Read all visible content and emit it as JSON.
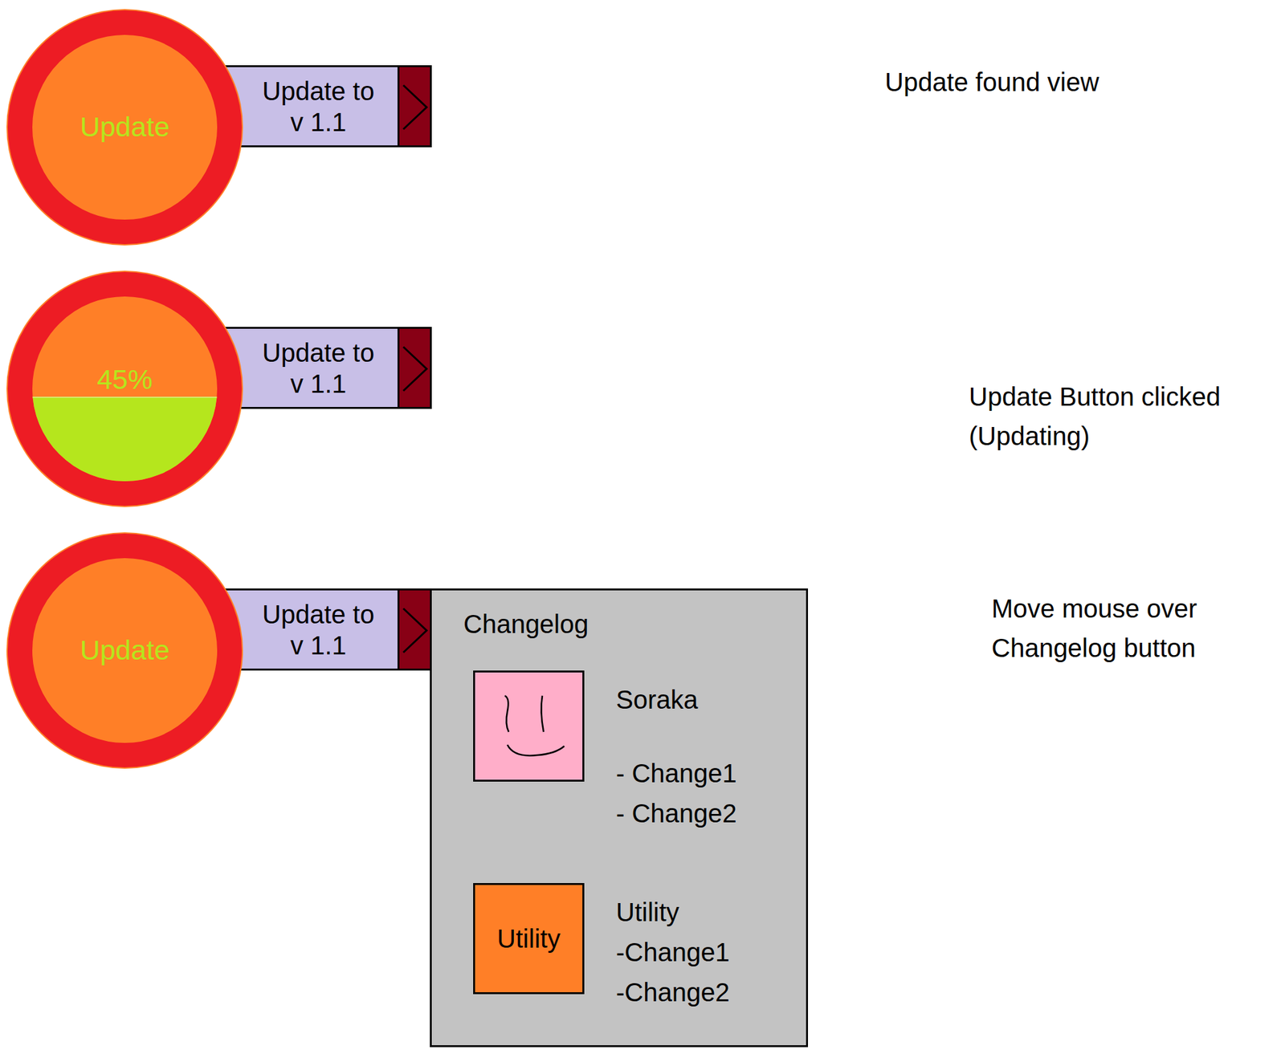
{
  "views": [
    {
      "kind": "idle",
      "button_label": "Update",
      "target": {
        "line1": "Update to",
        "line2": "v 1.1"
      },
      "changelog_open": false,
      "annotation": [
        "Update found view"
      ]
    },
    {
      "kind": "progress",
      "button_label": "45%",
      "level": 0.45,
      "target": {
        "line1": "Update to",
        "line2": "v 1.1"
      },
      "changelog_open": false,
      "annotation": [
        "Update Button clicked",
        "(Updating)"
      ]
    },
    {
      "kind": "idle",
      "button_label": "Update",
      "target": {
        "line1": "Update to",
        "line2": "v 1.1"
      },
      "changelog_open": true,
      "annotation": [
        "Move mouse over",
        "Changelog button"
      ]
    }
  ],
  "changelog": {
    "title": "Changelog",
    "sections": [
      {
        "name": "Soraka",
        "kind": "face",
        "color": "#ffaec9",
        "changes": [
          "- Change1",
          "- Change2"
        ]
      },
      {
        "name": "Utility",
        "kind": "label",
        "icon_label": "Utility",
        "color": "#ff7f27",
        "changes": [
          "-Change1",
          "-Change2"
        ]
      }
    ]
  }
}
